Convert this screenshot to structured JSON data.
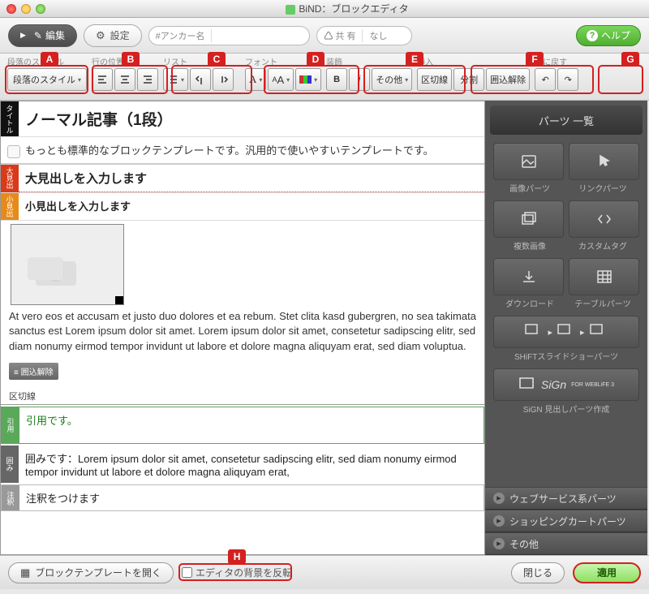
{
  "window": {
    "title": "BiND：ブロックエディタ"
  },
  "topbar": {
    "edit": "編集",
    "settings": "設定",
    "anchor_label": "#アンカー名",
    "anchor_value": "",
    "share_label": "共 有",
    "share_value": "なし",
    "help": "ヘルプ"
  },
  "groups": {
    "para": {
      "label": "段落のスタイル",
      "btn": "段落のスタイル"
    },
    "align": {
      "label": "行の位置"
    },
    "list": {
      "label": "リスト"
    },
    "font": {
      "label": "フォント"
    },
    "decor": {
      "label": "装飾",
      "other": "その他"
    },
    "insert": {
      "label": "挿入",
      "sep": "区切線",
      "split": "分割",
      "unwrap": "囲込解除"
    },
    "undo": {
      "label": "元に戻す"
    }
  },
  "badges": {
    "A": "A",
    "B": "B",
    "C": "C",
    "D": "D",
    "E": "E",
    "F": "F",
    "G": "G",
    "H": "H"
  },
  "editor": {
    "tag_title": "タイトル",
    "tag_h1": "大見出",
    "tag_h2": "小見出",
    "tag_quote": "引用",
    "tag_box": "囲み",
    "tag_note": "注釈",
    "title": "ノーマル記事（1段）",
    "desc": "もっとも標準的なブロックテンプレートです。汎用的で使いやすいテンプレートです。",
    "h1": "大見出しを入力します",
    "h2": "小見出しを入力します",
    "body": "At vero eos et accusam et justo duo dolores et ea rebum. Stet clita kasd gubergren, no sea takimata sanctus est Lorem ipsum dolor sit amet. Lorem ipsum dolor sit amet, consetetur sadipscing elitr, sed diam nonumy eirmod tempor invidunt ut labore et dolore magna aliquyam erat, sed diam voluptua.",
    "chip_unwrap": "囲込解除",
    "sep": "区切線",
    "quote": "引用です。",
    "box": "囲みです：Lorem ipsum dolor sit amet, consetetur sadipscing elitr, sed diam nonumy eirmod tempor invidunt ut labore et dolore magna aliquyam erat,",
    "note": "注釈をつけます"
  },
  "sidebar": {
    "header": "パーツ 一覧",
    "image": "画像パーツ",
    "link": "リンクパーツ",
    "multi": "複数画像",
    "custom": "カスタムタグ",
    "download": "ダウンロード",
    "table": "テーブルパーツ",
    "slideshow": "SHiFTスライドショーパーツ",
    "sign_brand": "SiGn",
    "sign_sub": "FOR WEBLiFE 3",
    "sign": "SiGN 見出しパーツ作成",
    "acc1": "ウェブサービス系パーツ",
    "acc2": "ショッピングカートパーツ",
    "acc3": "その他"
  },
  "bottom": {
    "open_template": "ブロックテンプレートを開く",
    "invert_bg": "エディタの背景を反転",
    "close": "閉じる",
    "apply": "適用"
  }
}
